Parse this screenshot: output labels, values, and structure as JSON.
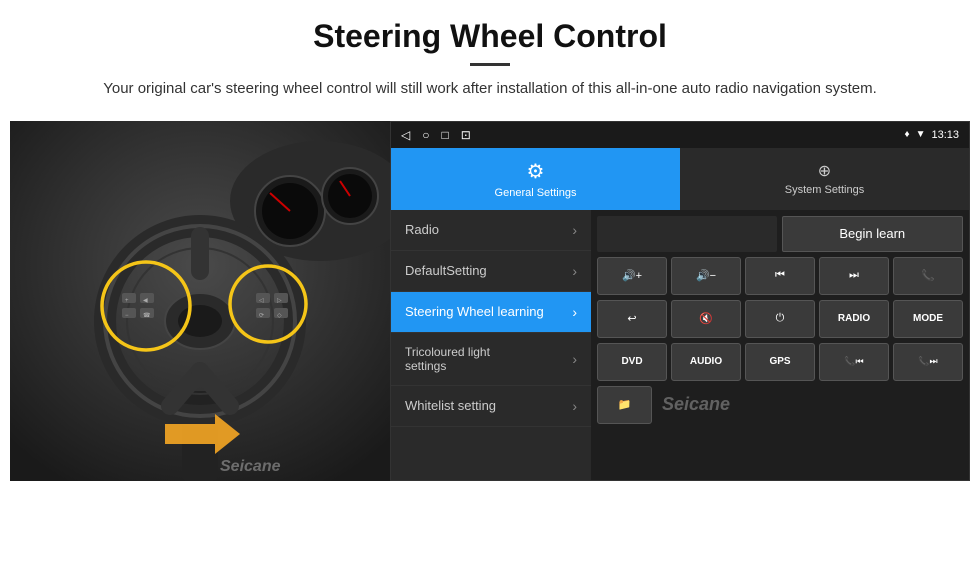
{
  "header": {
    "title": "Steering Wheel Control",
    "subtitle": "Your original car's steering wheel control will still work after installation of this all-in-one auto radio navigation system."
  },
  "status_bar": {
    "time": "13:13",
    "icons": [
      "◁",
      "○",
      "□",
      "⊡"
    ],
    "right_icons": [
      "♥",
      "▼"
    ]
  },
  "tabs": [
    {
      "id": "general",
      "label": "General Settings",
      "icon": "⚙",
      "active": true
    },
    {
      "id": "system",
      "label": "System Settings",
      "icon": "⚙",
      "active": false
    }
  ],
  "menu_items": [
    {
      "id": "radio",
      "label": "Radio",
      "active": false
    },
    {
      "id": "default",
      "label": "DefaultSetting",
      "active": false
    },
    {
      "id": "steering",
      "label": "Steering Wheel learning",
      "active": true
    },
    {
      "id": "tricoloured",
      "label": "Tricoloured light settings",
      "active": false
    },
    {
      "id": "whitelist",
      "label": "Whitelist setting",
      "active": false
    }
  ],
  "right_panel": {
    "begin_learn_label": "Begin learn",
    "buttons_row1": [
      {
        "label": "🔊+",
        "id": "vol-up"
      },
      {
        "label": "🔊−",
        "id": "vol-down"
      },
      {
        "label": "⏮",
        "id": "prev"
      },
      {
        "label": "⏭",
        "id": "next"
      },
      {
        "label": "📞",
        "id": "call"
      }
    ],
    "buttons_row2": [
      {
        "label": "↩",
        "id": "hang"
      },
      {
        "label": "🔇",
        "id": "mute"
      },
      {
        "label": "⏻",
        "id": "power"
      },
      {
        "label": "RADIO",
        "id": "radio"
      },
      {
        "label": "MODE",
        "id": "mode"
      }
    ],
    "buttons_row3": [
      {
        "label": "DVD",
        "id": "dvd"
      },
      {
        "label": "AUDIO",
        "id": "audio"
      },
      {
        "label": "GPS",
        "id": "gps"
      },
      {
        "label": "📞⏮",
        "id": "call-prev"
      },
      {
        "label": "📞⏭",
        "id": "call-next"
      }
    ]
  },
  "watermark": "Seicane"
}
